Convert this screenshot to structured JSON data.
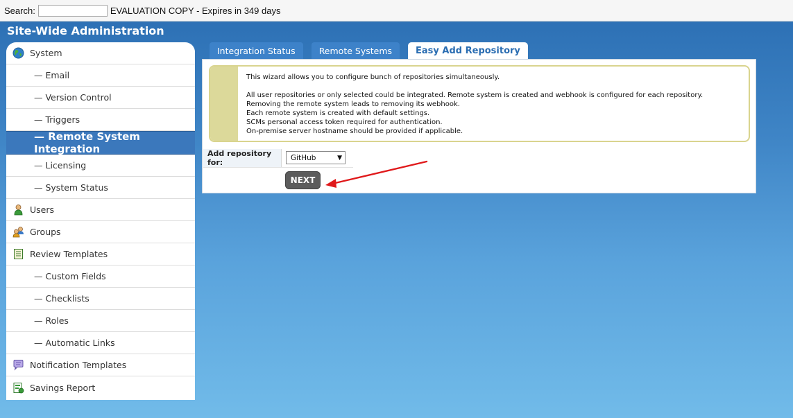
{
  "topbar": {
    "search_label": "Search:",
    "search_value": "",
    "evaluation_text": "EVALUATION COPY - Expires in 349 days"
  },
  "page": {
    "title": "Site-Wide Administration"
  },
  "sidebar": {
    "items": [
      {
        "label": "System",
        "level": "top",
        "icon": "globe-icon"
      },
      {
        "label": "— Email",
        "level": "sub"
      },
      {
        "label": "— Version Control",
        "level": "sub"
      },
      {
        "label": "— Triggers",
        "level": "sub"
      },
      {
        "label": "— Remote System Integration",
        "level": "sub",
        "active": true
      },
      {
        "label": "— Licensing",
        "level": "sub"
      },
      {
        "label": "— System Status",
        "level": "sub"
      },
      {
        "label": "Users",
        "level": "top",
        "icon": "user-icon"
      },
      {
        "label": "Groups",
        "level": "top",
        "icon": "group-icon"
      },
      {
        "label": "Review Templates",
        "level": "top",
        "icon": "template-icon"
      },
      {
        "label": "— Custom Fields",
        "level": "sub"
      },
      {
        "label": "— Checklists",
        "level": "sub"
      },
      {
        "label": "— Roles",
        "level": "sub"
      },
      {
        "label": "— Automatic Links",
        "level": "sub"
      },
      {
        "label": "Notification Templates",
        "level": "top",
        "icon": "speech-bubble-icon"
      },
      {
        "label": "Savings Report",
        "level": "top",
        "icon": "report-icon"
      }
    ]
  },
  "tabs": [
    {
      "label": "Integration Status"
    },
    {
      "label": "Remote Systems"
    },
    {
      "label": "Easy Add Repository",
      "active": true
    }
  ],
  "info": {
    "line1": "This wizard allows you to configure bunch of repositories simultaneously.",
    "line2": "All user repositories or only selected could be integrated. Remote system is created and webhook is configured for each repository.",
    "line3": "Removing the remote system leads to removing its webhook.",
    "line4": "Each remote system is created with default settings.",
    "line5": "SCMs personal access token required for authentication.",
    "line6": "On-premise server hostname should be provided if applicable."
  },
  "form": {
    "label": "Add repository for:",
    "selected_value": "GitHub",
    "caret": "▼",
    "next_label": "NEXT"
  },
  "colors": {
    "accent": "#3b78bc",
    "background_top": "#2a6db2",
    "background_bottom": "#71bbe9",
    "info_stripe": "#dcd99a",
    "arrow": "#e0191b"
  }
}
